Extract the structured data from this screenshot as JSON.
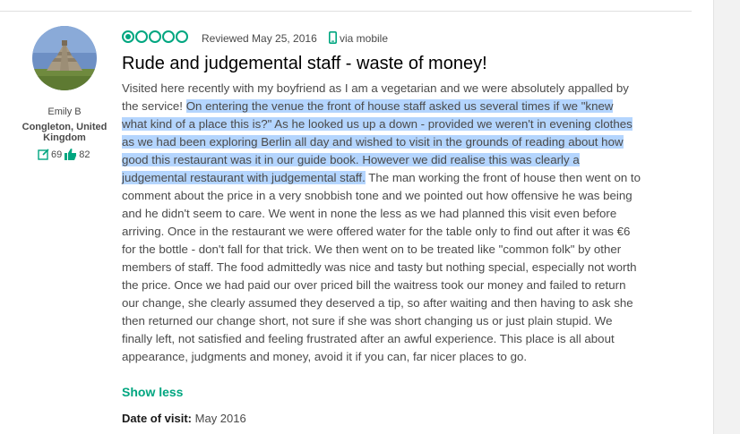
{
  "reviewer": {
    "name": "Emily B",
    "location": "Congleton, United Kingdom",
    "reviews_count": "69",
    "helpful_votes": "82"
  },
  "review": {
    "rating": 1,
    "rating_max": 5,
    "date": "Reviewed May 25, 2016",
    "via": "via mobile",
    "title": "Rude and judgemental staff - waste of money!",
    "text_before": "Visited here recently with my boyfriend as I am a vegetarian and we were absolutely appalled by the service! ",
    "text_highlighted": "On entering the venue the front of house staff asked us several times if we \"knew what kind of a place this is?\" As he looked us up a down - provided we weren't in evening clothes as we had been exploring Berlin all day and wished to visit in the grounds of reading about how good this restaurant was it in our guide book. However we did realise this was clearly a judgemental restaurant with judgemental staff.",
    "text_after": " The man working the front of house then went on to comment about the price in a very snobbish tone and we pointed out how offensive he was being and he didn't seem to care. We went in none the less as we had planned this visit even before arriving. Once in the restaurant we were offered water for the table only to find out after it was €6 for the bottle - don't fall for that trick. We then went on to be treated like \"common folk\" by other members of staff. The food admittedly was nice and tasty but nothing special, especially not worth the price. Once we had paid our over priced bill the waitress took our money and failed to return our change, she clearly assumed they deserved a tip, so after waiting and then having to ask she then returned our change short, not sure if she was short changing us or just plain stupid. We finally left, not satisfied and feeling frustrated after an awful experience. This place is all about appearance, judgments and money, avoid it if you can, far nicer places to go.",
    "show_less": "Show less",
    "visit_label": "Date of visit:",
    "visit_date": "May 2016"
  },
  "colors": {
    "bubble": "#00a680",
    "highlight": "#b4d5fe",
    "text": "#4a4a4a"
  }
}
